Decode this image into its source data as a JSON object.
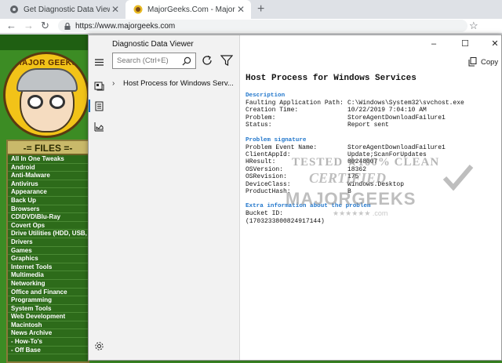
{
  "browser": {
    "tabs": [
      {
        "label": "Get Diagnostic Data Viewer - Ma",
        "active": false
      },
      {
        "label": "MajorGeeks.Com - MajorGeeks",
        "active": true
      }
    ],
    "url": "https://www.majorgeeks.com"
  },
  "site": {
    "logo_text": "MAJOR GEEKS",
    "files_title": "-= FILES =-",
    "files": [
      "All In One Tweaks",
      "Android",
      "Anti-Malware",
      "Antivirus",
      "Appearance",
      "Back Up",
      "Browsers",
      "CD\\DVD\\Blu-Ray",
      "Covert Ops",
      "Drive Utilities (HDD, USB, DVD)",
      "Drivers",
      "Games",
      "Graphics",
      "Internet Tools",
      "Multimedia",
      "Networking",
      "Office and Finance",
      "Programming",
      "System Tools",
      "Web Development",
      "Macintosh",
      "News Archive",
      "- How-To's",
      "- Off Base"
    ]
  },
  "app": {
    "title": "Diagnostic Data Viewer",
    "search_placeholder": "Search (Ctrl+E)",
    "list_item": "Host Process for Windows Serv...",
    "copy_label": "Copy",
    "window_controls": {
      "min": "–",
      "max": "☐",
      "close": "✕"
    },
    "detail": {
      "title": "Host Process for Windows Services",
      "description_head": "Description",
      "description": [
        {
          "k": "Faulting Application Path:",
          "v": "C:\\Windows\\System32\\svchost.exe"
        },
        {
          "k": "Creation Time:",
          "v": "10/22/2019 7:04:10 AM"
        },
        {
          "k": "Problem:",
          "v": "StoreAgentDownloadFailure1"
        },
        {
          "k": "Status:",
          "v": "Report sent"
        }
      ],
      "signature_head": "Problem signature",
      "signature": [
        {
          "k": "Problem Event Name:",
          "v": "StoreAgentDownloadFailure1"
        },
        {
          "k": "ClientAppId:",
          "v": "Update;ScanForUpdates"
        },
        {
          "k": "HResult:",
          "v": "80248007"
        },
        {
          "k": "OSVersion:",
          "v": "18362"
        },
        {
          "k": "OSRevision:",
          "v": "175"
        },
        {
          "k": "DeviceClass:",
          "v": "Windows.Desktop"
        },
        {
          "k": "ProductHash:",
          "v": "B"
        }
      ],
      "extra_head": "Extra information about the problem",
      "extra": [
        "Bucket ID:",
        "(1703233800824917144)"
      ]
    }
  },
  "watermark": {
    "top": "TESTED ★100% CLEAN",
    "mid": "CERTIFIED",
    "bot": "MAJORGEEKS",
    "stars": "★★★★★★ .com"
  },
  "colors": {
    "section_head": "#2277cc",
    "site_green": "#3c8c24",
    "files_header": "#c9b96a"
  }
}
